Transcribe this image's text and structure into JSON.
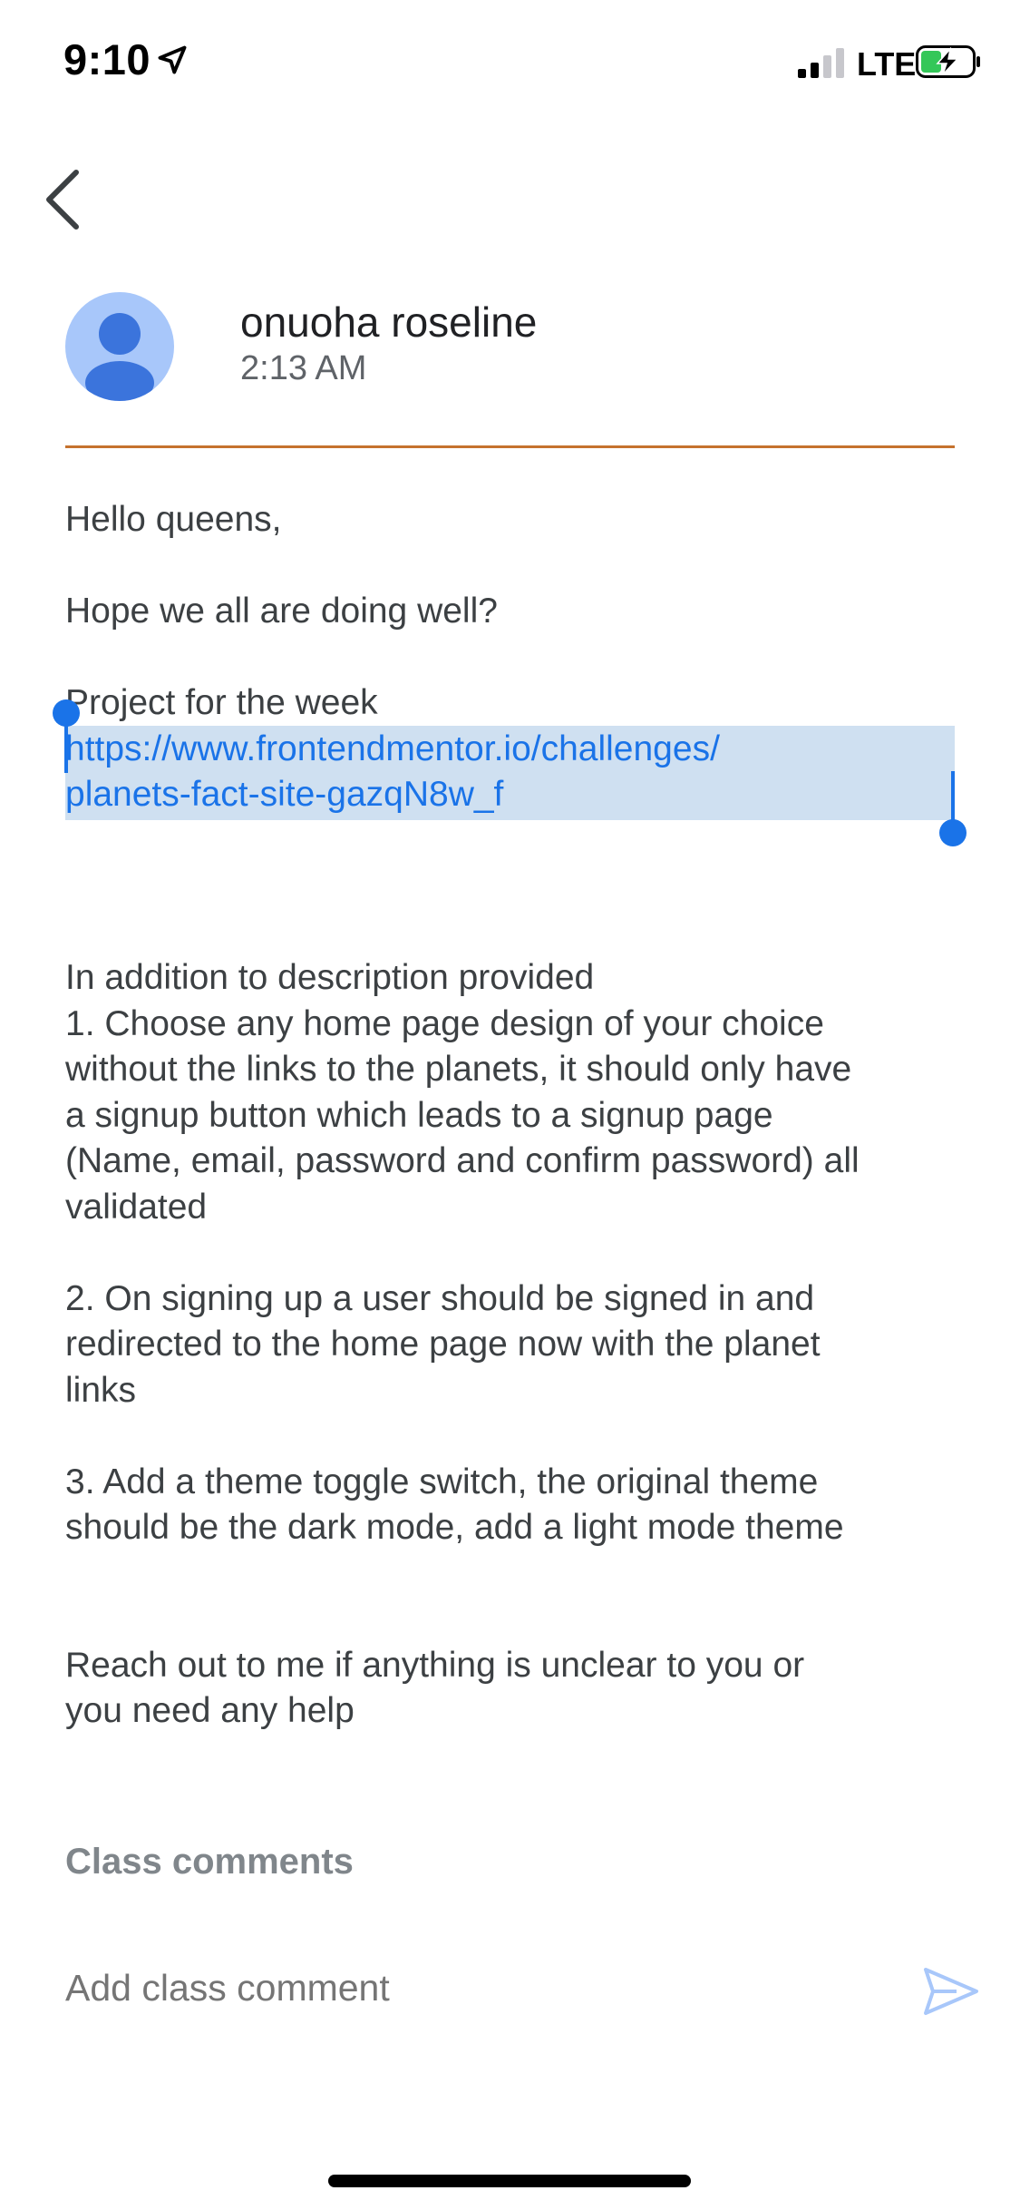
{
  "status_bar": {
    "time": "9:10",
    "network": "LTE"
  },
  "post": {
    "author": "onuoha roseline",
    "time": "2:13 AM",
    "body": {
      "greeting": "Hello queens,",
      "hope": "Hope we all are doing well?",
      "project_label": "Project for the week",
      "link_line1": "https://www.frontendmentor.io/challenges/",
      "link_line2": "planets-fact-site-gazqN8w_f",
      "p1_l1": "In addition to description provided",
      "p1_l2": "1. Choose any home page design of your choice",
      "p1_l3": "without the links to the planets, it should only have",
      "p1_l4": "a signup button which leads to a signup page",
      "p1_l5": "(Name, email, password and confirm password) all",
      "p1_l6": "validated",
      "p2_l1": "2. On signing up a user should be signed in and",
      "p2_l2": "redirected to the home page now with the planet",
      "p2_l3": "links",
      "p3_l1": "3. Add a theme toggle switch, the original theme",
      "p3_l2": "should be the dark mode, add a light mode theme",
      "p4_l1": "Reach out to me if anything is unclear to you or",
      "p4_l2": "you need any help"
    }
  },
  "comments": {
    "heading": "Class comments",
    "placeholder": "Add class comment"
  },
  "colors": {
    "accent": "#1a73e8",
    "divider": "#c5722e",
    "selection": "#cfe0f1",
    "avatar_bg": "#a8c7fa",
    "avatar_fg": "#3b74dc"
  }
}
